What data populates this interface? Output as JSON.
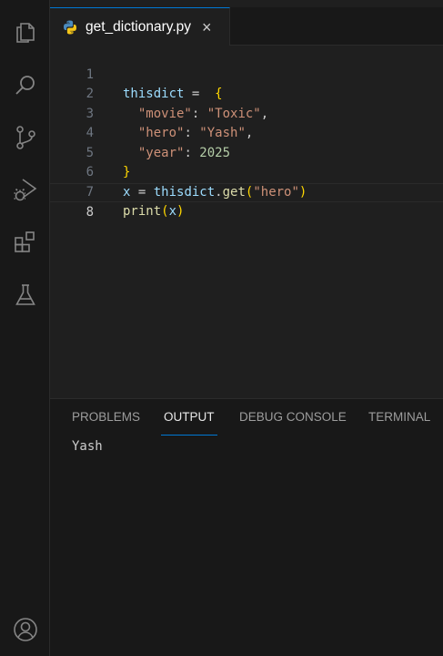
{
  "editor": {
    "tab": {
      "filename": "get_dictionary.py",
      "close_glyph": "×"
    },
    "line_numbers": [
      "1",
      "2",
      "3",
      "4",
      "5",
      "6",
      "7",
      "8"
    ],
    "tokens": {
      "l1_var": "thisdict",
      "l1_op": " = ",
      "l1_brace": "{",
      "l2_key": "\"movie\"",
      "l2_colon": ": ",
      "l2_val": "\"Toxic\"",
      "l2_comma": ",",
      "l3_key": "\"hero\"",
      "l3_colon": ": ",
      "l3_val": "\"Yash\"",
      "l3_comma": ",",
      "l4_key": "\"year\"",
      "l4_colon": ": ",
      "l4_val": "2025",
      "l5_brace": "}",
      "l6_var": "x",
      "l6_op": " = ",
      "l6_obj": "thisdict",
      "l6_dot": ".",
      "l6_fn": "get",
      "l6_lp": "(",
      "l6_arg": "\"hero\"",
      "l6_rp": ")",
      "l7_fn": "print",
      "l7_lp": "(",
      "l7_arg": "x",
      "l7_rp": ")"
    }
  },
  "panel": {
    "tabs": [
      "PROBLEMS",
      "OUTPUT",
      "DEBUG CONSOLE",
      "TERMINAL"
    ],
    "active_tab": "OUTPUT",
    "output": "Yash"
  },
  "activity_bar": {
    "icons": [
      "explorer-icon",
      "search-icon",
      "source-control-icon",
      "run-debug-icon",
      "extensions-icon",
      "testing-icon",
      "account-icon"
    ]
  },
  "colors": {
    "accent": "#0078d4",
    "editor_bg": "#1f1f1f",
    "sidebar_bg": "#181818"
  }
}
